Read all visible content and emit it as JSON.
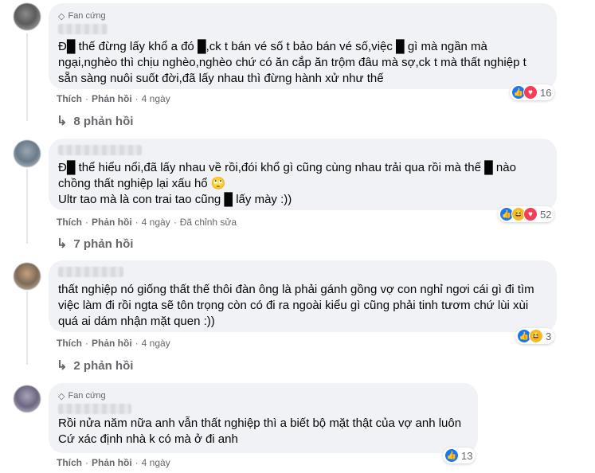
{
  "comments": [
    {
      "badge": "Fan cứng",
      "text_html": "Đ█ thế đừng lấy khổ a đó █,ck t bán vé số t bảo bán vé số,việc █ gì mà ngần mà ngại,nghèo thì chịu nghèo,nghèo chứ có ăn cắp ăn trộm đâu mà sợ,ck t mà thất nghiệp t sẵn sàng nuôi suốt đời,đã lấy nhau thì đừng hành xử như thế",
      "reaction_count": "16",
      "like": "Thích",
      "reply": "Phản hồi",
      "time": "4 ngày",
      "edited": "",
      "replies_label": "8 phản hồi"
    },
    {
      "badge": "",
      "text_html": "Đ█ thể hiểu nổi,đã lấy nhau về rồi,đói khổ gì cũng cùng nhau trải qua rồi mà thế █ nào chồng thất nghiệp lại xấu hổ 🙄\nUltr tao mà là con trai tao cũng █ lấy mày :))",
      "reaction_count": "52",
      "like": "Thích",
      "reply": "Phản hồi",
      "time": "4 ngày",
      "edited": "Đã chỉnh sửa",
      "replies_label": "7 phản hồi"
    },
    {
      "badge": "",
      "text_html": "thất nghiệp nó giống thất thế thôi đàn ông là phải gánh gồng vợ con nghỉ ngơi cái gì đi tìm việc làm đi rồi ngta sẽ tôn trọng còn có đi ra ngoài kiểu gì cũng phải tinh tươm chứ lùi xùi quá ai dám nhận mặt quen :))",
      "reaction_count": "3",
      "like": "Thích",
      "reply": "Phản hồi",
      "time": "4 ngày",
      "edited": "",
      "replies_label": "2 phản hồi"
    },
    {
      "badge": "Fan cứng",
      "text_html": "Rồi nửa năm nữa anh vẫn thất nghiệp thì a biết bộ mặt thật của vợ anh luôn\nCứ xác định nhà k có mà ở đi anh",
      "reaction_count": "13",
      "like": "Thích",
      "reply": "Phản hồi",
      "time": "4 ngày",
      "edited": "",
      "replies_label": ""
    }
  ]
}
